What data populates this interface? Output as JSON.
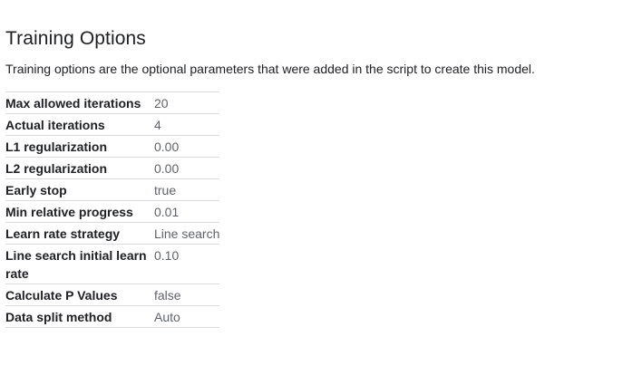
{
  "section": {
    "title": "Training Options",
    "description": "Training options are the optional parameters that were added in the script to create this model."
  },
  "options": [
    {
      "label": "Max allowed iterations",
      "value": "20"
    },
    {
      "label": "Actual iterations",
      "value": "4"
    },
    {
      "label": "L1 regularization",
      "value": "0.00"
    },
    {
      "label": "L2 regularization",
      "value": "0.00"
    },
    {
      "label": "Early stop",
      "value": "true"
    },
    {
      "label": "Min relative progress",
      "value": "0.01"
    },
    {
      "label": "Learn rate strategy",
      "value": "Line search"
    },
    {
      "label": "Line search initial learn rate",
      "value": "0.10"
    },
    {
      "label": "Calculate P Values",
      "value": "false"
    },
    {
      "label": "Data split method",
      "value": "Auto"
    }
  ]
}
